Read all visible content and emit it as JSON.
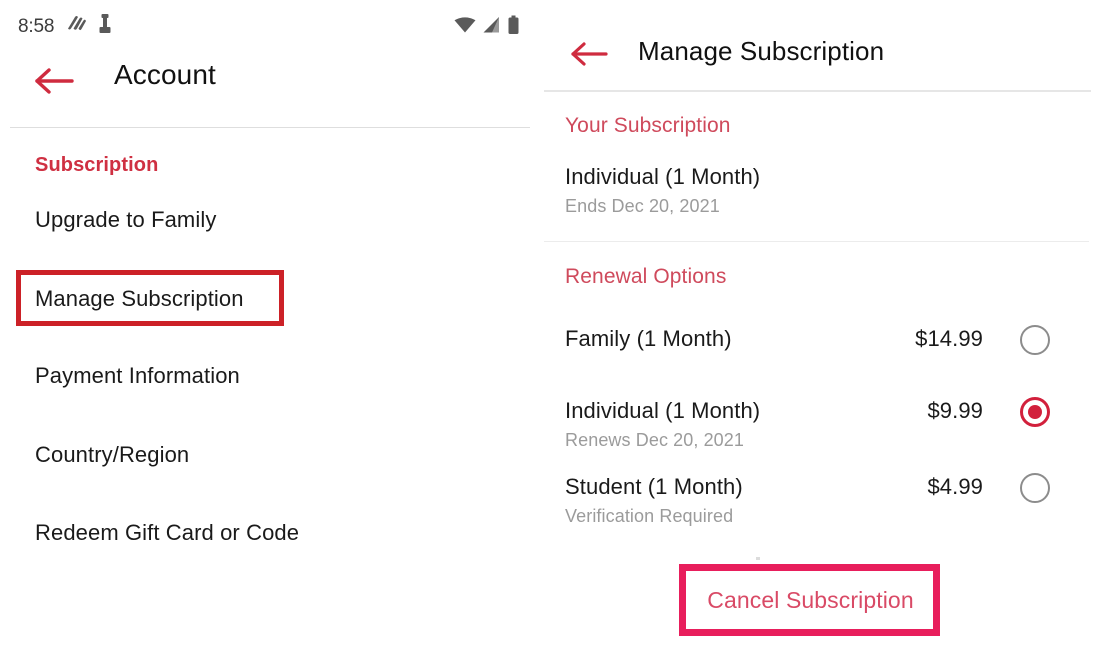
{
  "status_bar": {
    "time": "8:58",
    "notification_icons": [
      "app-notification-icon",
      "chess-piece-icon"
    ],
    "system_icons": [
      "wifi-icon",
      "cell-signal-icon",
      "battery-icon"
    ]
  },
  "left_panel": {
    "back_icon": "back-arrow-icon",
    "title": "Account",
    "section_header": "Subscription",
    "menu_items": [
      {
        "label": "Upgrade to Family"
      },
      {
        "label": "Manage Subscription"
      },
      {
        "label": "Payment Information"
      },
      {
        "label": "Country/Region"
      },
      {
        "label": "Redeem Gift Card or Code"
      }
    ],
    "highlight": {
      "target": "Manage Subscription",
      "color": "#cc2127"
    }
  },
  "right_panel": {
    "back_icon": "back-arrow-icon",
    "title": "Manage Subscription",
    "your_subscription": {
      "section_title": "Your Subscription",
      "plan_name": "Individual (1 Month)",
      "plan_detail": "Ends Dec 20, 2021"
    },
    "renewal_options": {
      "section_title": "Renewal Options",
      "options": [
        {
          "name": "Family (1 Month)",
          "detail": "",
          "price": "$14.99",
          "selected": false
        },
        {
          "name": "Individual (1 Month)",
          "detail": "Renews Dec 20, 2021",
          "price": "$9.99",
          "selected": true
        },
        {
          "name": "Student (1 Month)",
          "detail": "Verification Required",
          "price": "$4.99",
          "selected": false
        }
      ]
    },
    "cancel_button": {
      "label": "Cancel Subscription"
    },
    "highlight": {
      "target": "Cancel Subscription",
      "color": "#e81e5c"
    }
  },
  "colors": {
    "accent_red": "#cf3042",
    "section_pink": "#cf4a5c",
    "selected_radio": "#d2203c",
    "annotation_red": "#cc2127",
    "annotation_pink": "#e81e5c",
    "text_primary": "#1a1a1a",
    "text_muted": "#9b9b9b"
  }
}
